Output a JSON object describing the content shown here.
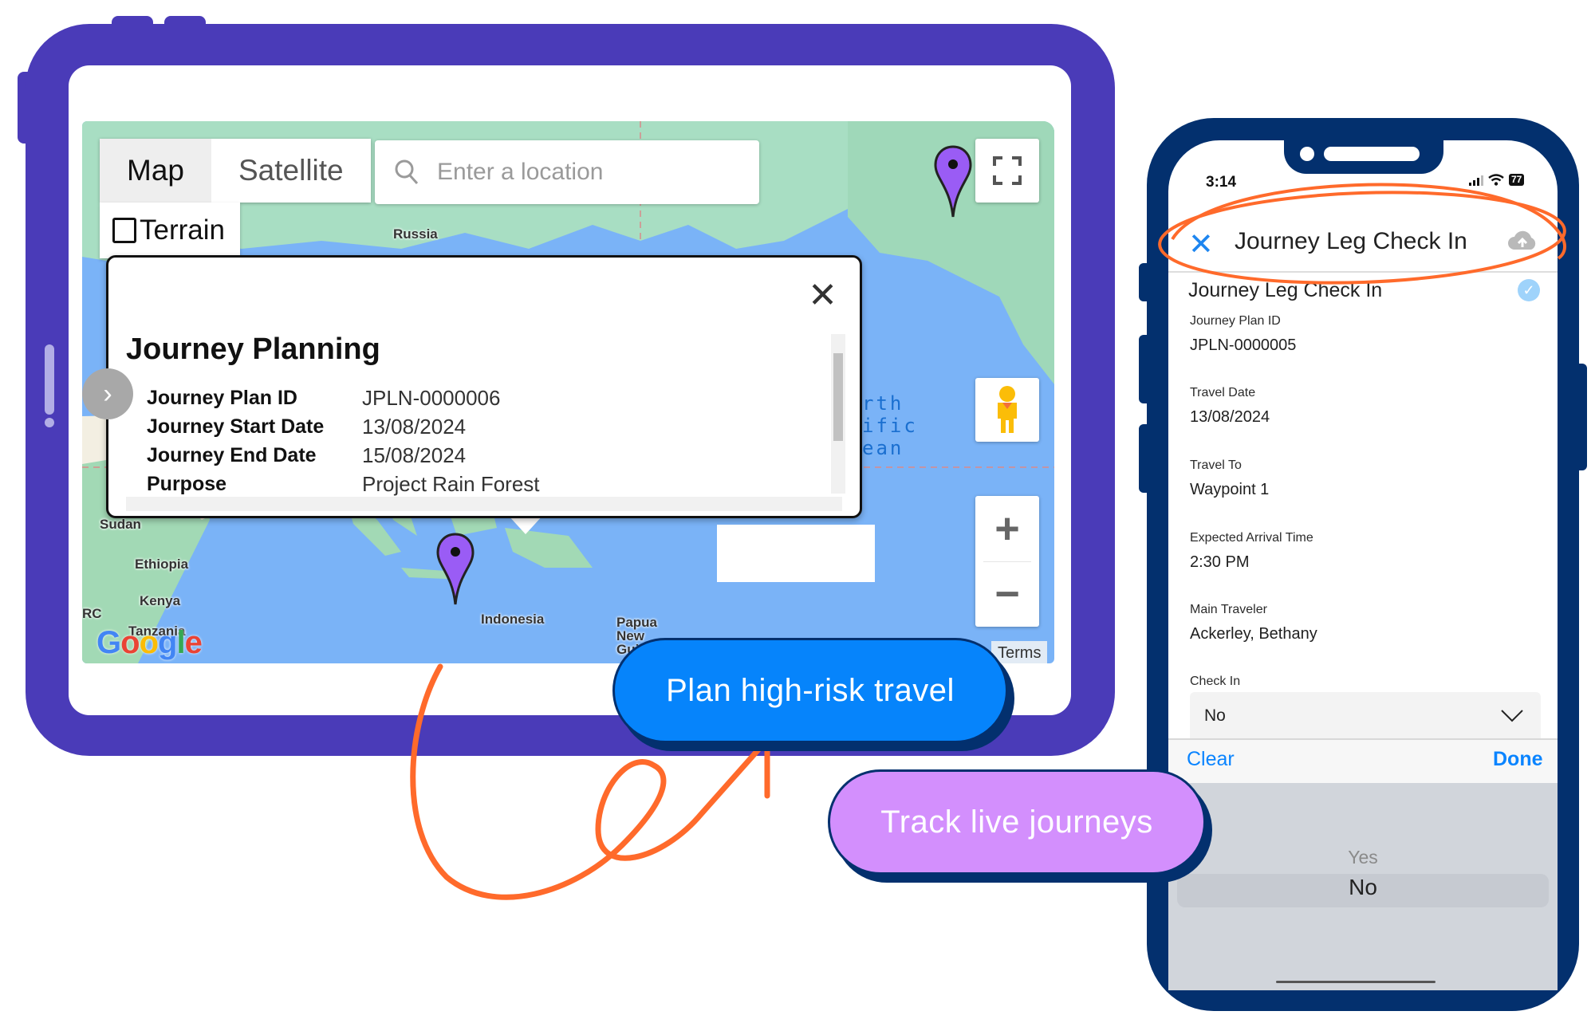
{
  "tablet": {
    "map": {
      "map_types": [
        {
          "label": "Map",
          "active": true
        },
        {
          "label": "Satellite",
          "active": false
        }
      ],
      "terrain_label": "Terrain",
      "terrain_checked": false,
      "search": {
        "placeholder": "Enter a location",
        "value": ""
      },
      "place_labels": [
        "Russia",
        "Sudan",
        "Ethiopia",
        "Kenya",
        "RC",
        "Tanzania",
        "Indonesia",
        "Papua New Guinea"
      ],
      "ocean_label": [
        "rth",
        "ific",
        "ean"
      ],
      "terms_label": "Terms",
      "google_logo": "Google",
      "marker_color": "#9a5cf5",
      "controls": {
        "fullscreen_icon": "fullscreen-icon",
        "pegman_icon": "street-view-pegman-icon",
        "zoom_in": "+",
        "zoom_out": "−"
      },
      "info_window": {
        "title": "Journey Planning",
        "close_label": "✕",
        "rows": [
          {
            "key": "Journey Plan ID",
            "value": "JPLN-0000006"
          },
          {
            "key": "Journey Start Date",
            "value": "13/08/2024"
          },
          {
            "key": "Journey End Date",
            "value": "15/08/2024"
          },
          {
            "key": "Purpose",
            "value": "Project Rain Forest"
          }
        ]
      },
      "expand_icon": "›"
    }
  },
  "callouts": {
    "plan": "Plan high-risk travel",
    "track": "Track live journeys"
  },
  "colors": {
    "tablet_frame": "#4a3bb8",
    "phone_frame": "#03306e",
    "plan_pill": "#0684fb",
    "track_pill": "#d38ffd",
    "annotation": "#ff6a2b",
    "ios_blue": "#0a84ff"
  },
  "phone": {
    "status": {
      "time": "3:14",
      "battery": "77"
    },
    "header": {
      "title": "Journey Leg Check In",
      "close_icon": "✕"
    },
    "section_title": "Journey Leg Check In",
    "fields": [
      {
        "label": "Journey Plan ID",
        "value": "JPLN-0000005"
      },
      {
        "label": "Travel Date",
        "value": "13/08/2024"
      },
      {
        "label": "Travel To",
        "value": "Waypoint 1"
      },
      {
        "label": "Expected Arrival Time",
        "value": "2:30 PM"
      },
      {
        "label": "Main Traveler",
        "value": "Ackerley, Bethany"
      }
    ],
    "check_in": {
      "label": "Check In",
      "value": "No"
    },
    "toolbar": {
      "clear": "Clear",
      "done": "Done"
    },
    "picker": {
      "options": [
        "Yes",
        "No"
      ],
      "selected": "No"
    }
  }
}
